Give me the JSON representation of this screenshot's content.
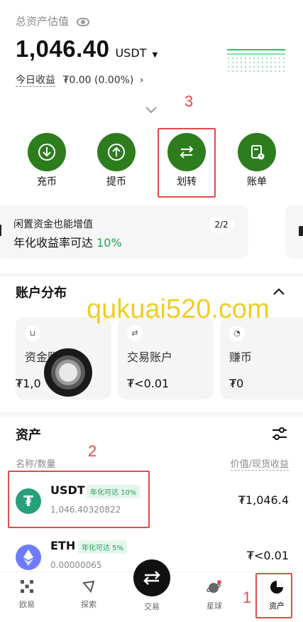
{
  "header": {
    "title": "总资产估值",
    "total_value": "1,046.40",
    "currency": "USDT",
    "today_label": "今日收益",
    "today_value": "₮0.00 (0.00%)"
  },
  "actions": [
    {
      "label": "充币",
      "icon": "deposit-icon"
    },
    {
      "label": "提币",
      "icon": "withdraw-icon"
    },
    {
      "label": "划转",
      "icon": "transfer-icon"
    },
    {
      "label": "账单",
      "icon": "bill-icon"
    }
  ],
  "promo": {
    "title": "闲置资金也能增值",
    "subtitle_prefix": "年化收益率可达 ",
    "subtitle_rate": "10%",
    "pager": "2/2"
  },
  "account_section": {
    "title": "账户分布",
    "cards": [
      {
        "name": "资金账户",
        "value": "₮1,0",
        "icon": "wallet-icon"
      },
      {
        "name": "交易账户",
        "value": "₮<0.01",
        "icon": "swap-icon"
      },
      {
        "name": "赚币",
        "value": "₮0",
        "icon": "earn-icon"
      }
    ]
  },
  "assets_section": {
    "title": "资产",
    "col_left": "名称/数量",
    "col_right": "价值/现货收益",
    "rows": [
      {
        "symbol": "USDT",
        "tag": "年化可达 10%",
        "amount": "1,046.40320822",
        "value": "₮1,046.4"
      },
      {
        "symbol": "ETH",
        "tag": "年化可达 5%",
        "amount": "0.00000065",
        "value": "₮<0.01"
      }
    ]
  },
  "watermark": "qukuai520.com",
  "annotations": [
    "1",
    "2",
    "3"
  ],
  "bottom_nav": [
    {
      "label": "欧易",
      "icon": "okx-logo-icon"
    },
    {
      "label": "探索",
      "icon": "compass-icon"
    },
    {
      "label": "交易",
      "icon": "trade-icon"
    },
    {
      "label": "星球",
      "icon": "planet-icon"
    },
    {
      "label": "资产",
      "icon": "pie-chart-icon"
    }
  ],
  "colors": {
    "brand": "#2d7d1e",
    "positive": "#26a05a",
    "annotation": "#e34b4b",
    "watermark": "#f2c400"
  }
}
